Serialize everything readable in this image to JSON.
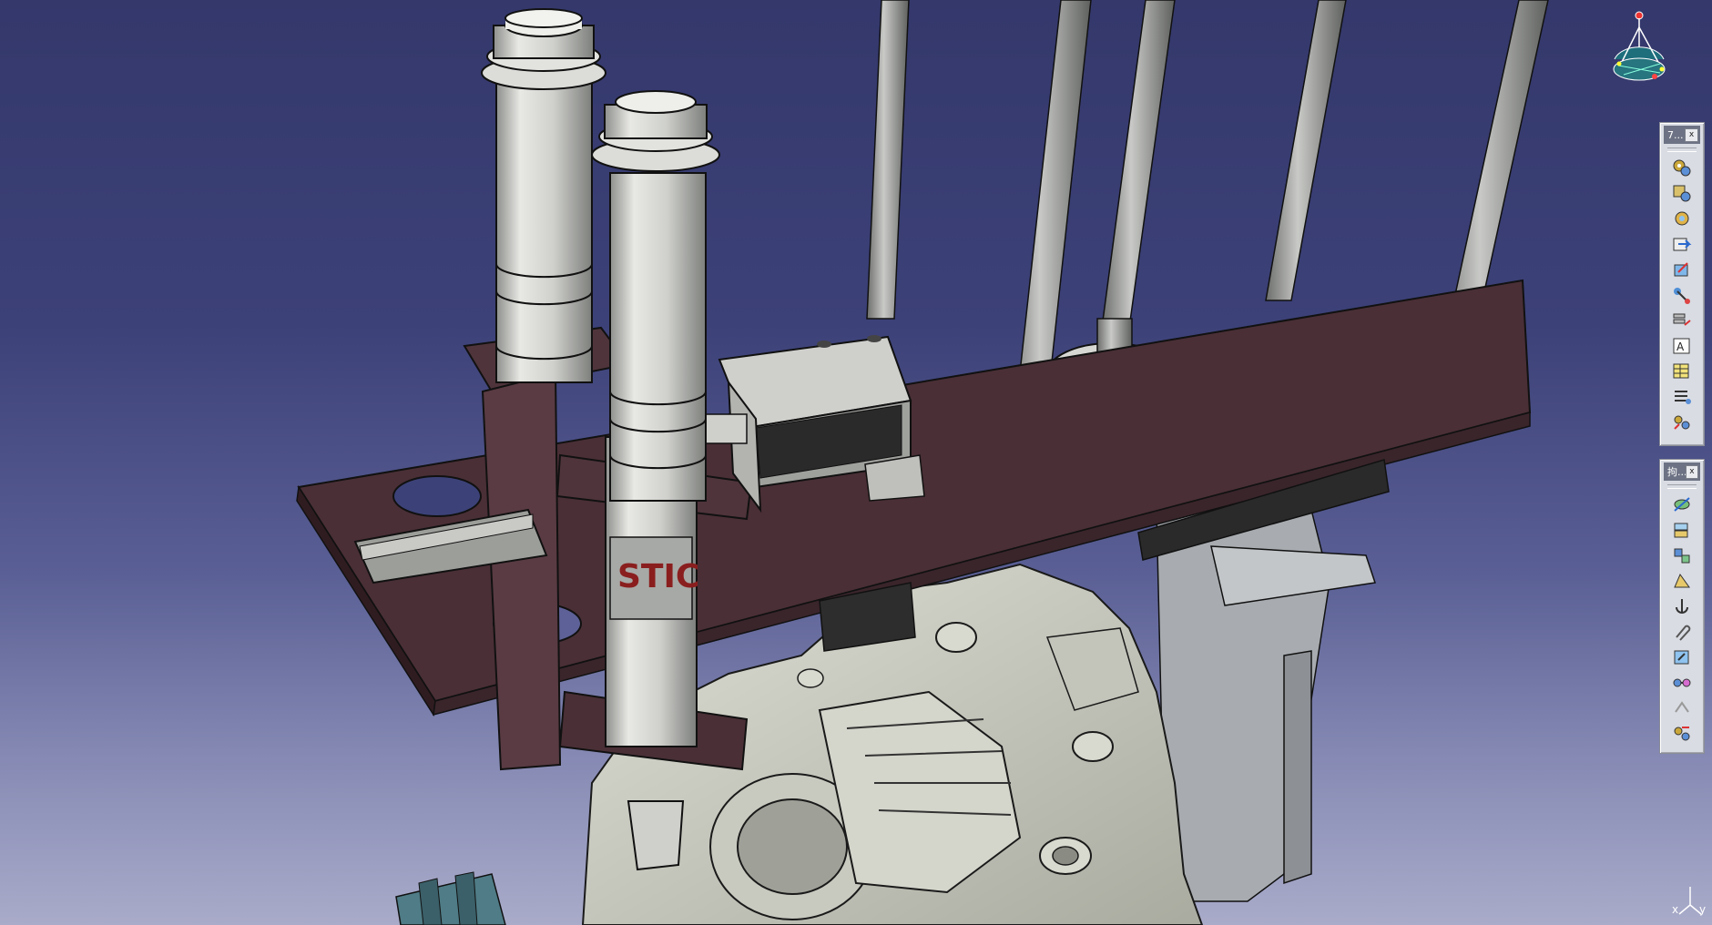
{
  "viewport": {
    "background_top": "#34386b",
    "background_bottom": "#a9abc9",
    "model_decal_text": "STIC",
    "model_colors": {
      "plate": "#4a2f36",
      "steel": "#bcbdba",
      "casting": "#cfcfc4",
      "block": "#aeb2b4"
    }
  },
  "compass": {
    "icon": "compass-icon"
  },
  "toolbar_top": {
    "title": "7...",
    "close_label": "x",
    "buttons": [
      {
        "name": "assembly-gears-icon"
      },
      {
        "name": "component-gears-icon"
      },
      {
        "name": "gear-settings-icon"
      },
      {
        "name": "move-arrow-icon"
      },
      {
        "name": "snap-arrow-icon"
      },
      {
        "name": "fix-pin-icon"
      },
      {
        "name": "stack-arrow-icon"
      },
      {
        "name": "text-box-icon"
      },
      {
        "name": "table-sheet-icon"
      },
      {
        "name": "reorder-list-icon"
      },
      {
        "name": "explode-gears-icon"
      }
    ]
  },
  "toolbar_bottom": {
    "title": "拘...",
    "close_label": "x",
    "buttons": [
      {
        "name": "coincidence-constraint-icon"
      },
      {
        "name": "contact-constraint-icon"
      },
      {
        "name": "offset-constraint-icon"
      },
      {
        "name": "angle-constraint-icon"
      },
      {
        "name": "fix-anchor-icon"
      },
      {
        "name": "fix-together-icon"
      },
      {
        "name": "quick-constraint-icon"
      },
      {
        "name": "flexible-link-icon"
      },
      {
        "name": "change-constraint-icon"
      },
      {
        "name": "reuse-pattern-icon"
      }
    ]
  },
  "axis": {
    "x_label": "x",
    "y_label": "y"
  }
}
